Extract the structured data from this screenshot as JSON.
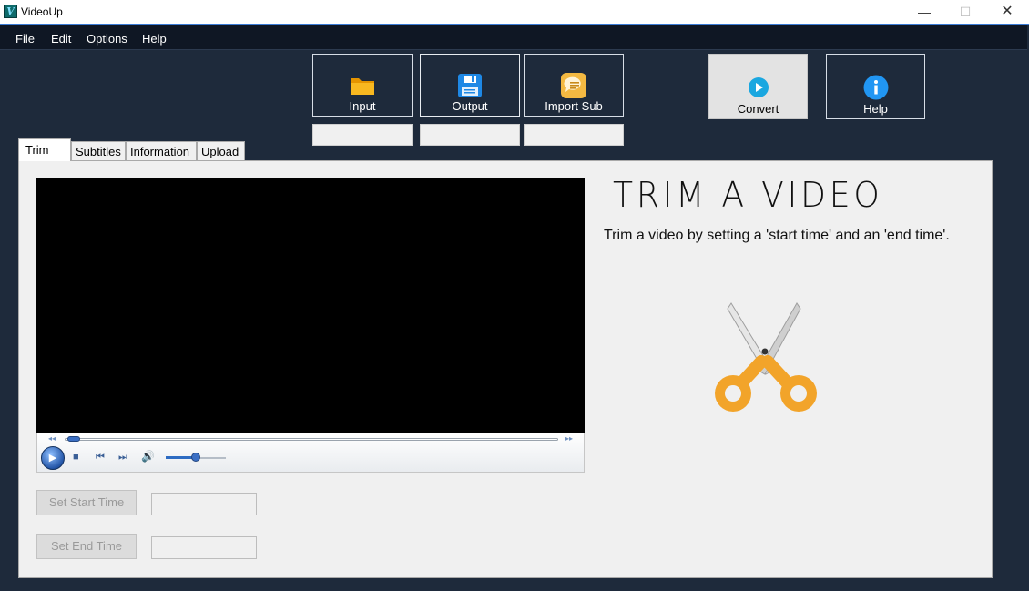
{
  "window": {
    "title": "VideoUp",
    "app_icon_glyph": "V",
    "min_glyph": "—",
    "max_glyph": "☐",
    "close_glyph": "✕"
  },
  "menu": {
    "items": [
      "File",
      "Edit",
      "Options",
      "Help"
    ]
  },
  "toolbar": {
    "input_label": "Input",
    "output_label": "Output",
    "import_sub_label": "Import Sub",
    "convert_label": "Convert",
    "help_label": "Help",
    "input_path": "",
    "output_path": "",
    "subtitle_path": ""
  },
  "tabs": [
    {
      "label": "Trim",
      "active": true
    },
    {
      "label": "Subtitles",
      "active": false
    },
    {
      "label": "Information",
      "active": false
    },
    {
      "label": "Upload",
      "active": false
    }
  ],
  "trim": {
    "title": "TRIM A VIDEO",
    "description": "Trim a video by setting a 'start time' and an 'end time'.",
    "set_start_label": "Set Start Time",
    "set_end_label": "Set End Time",
    "start_time_value": "",
    "end_time_value": ""
  },
  "player": {
    "seek_position": 0.01,
    "volume_level": 0.5,
    "rewind_glyph": "◂◂",
    "forward_glyph": "▸▸",
    "play_glyph": "▶",
    "stop_glyph": "■",
    "prev_glyph": "⏮",
    "next_glyph": "⏭",
    "volume_glyph": "🔊"
  },
  "colors": {
    "window_bg": "#1e2a3b",
    "menubar_bg": "#0f1724",
    "panel_bg": "#f0f0f0",
    "folder": "#f4b400",
    "accent_blue": "#1e88e5",
    "scissors_orange": "#f2a42a"
  }
}
